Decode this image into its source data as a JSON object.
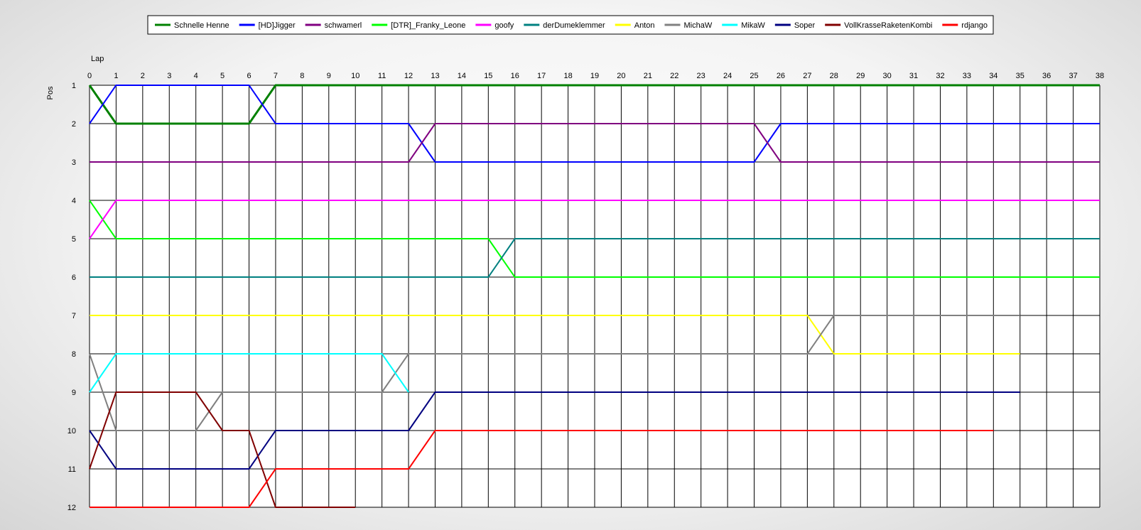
{
  "chart_data": {
    "type": "line",
    "xlabel": "Lap",
    "ylabel": "Pos",
    "xlim": [
      0,
      38
    ],
    "ylim": [
      1,
      12
    ],
    "y_inverted": true,
    "x_ticks": [
      0,
      1,
      2,
      3,
      4,
      5,
      6,
      7,
      8,
      9,
      10,
      11,
      12,
      13,
      14,
      15,
      16,
      17,
      18,
      19,
      20,
      21,
      22,
      23,
      24,
      25,
      26,
      27,
      28,
      29,
      30,
      31,
      32,
      33,
      34,
      35,
      36,
      37,
      38
    ],
    "y_ticks": [
      1,
      2,
      3,
      4,
      5,
      6,
      7,
      8,
      9,
      10,
      11,
      12
    ],
    "grid": true,
    "legend_position": "top-center",
    "series": [
      {
        "name": "Schnelle Henne",
        "color": "#008000",
        "width": 3,
        "points": [
          [
            0,
            1
          ],
          [
            1,
            2
          ],
          [
            6,
            2
          ],
          [
            7,
            1
          ],
          [
            38,
            1
          ]
        ]
      },
      {
        "name": "[HD]Jigger",
        "color": "#0000ff",
        "width": 2,
        "points": [
          [
            0,
            2
          ],
          [
            1,
            1
          ],
          [
            6,
            1
          ],
          [
            7,
            2
          ],
          [
            12,
            2
          ],
          [
            13,
            3
          ],
          [
            25,
            3
          ],
          [
            26,
            2
          ],
          [
            38,
            2
          ]
        ]
      },
      {
        "name": "schwamerl",
        "color": "#800080",
        "width": 2,
        "points": [
          [
            0,
            3
          ],
          [
            12,
            3
          ],
          [
            13,
            2
          ],
          [
            25,
            2
          ],
          [
            26,
            3
          ],
          [
            38,
            3
          ]
        ]
      },
      {
        "name": "[DTR]_Franky_Leone",
        "color": "#00ff00",
        "width": 2,
        "points": [
          [
            0,
            4
          ],
          [
            1,
            5
          ],
          [
            15,
            5
          ],
          [
            16,
            6
          ],
          [
            38,
            6
          ]
        ]
      },
      {
        "name": "goofy",
        "color": "#ff00ff",
        "width": 2,
        "points": [
          [
            0,
            5
          ],
          [
            1,
            4
          ],
          [
            38,
            4
          ]
        ]
      },
      {
        "name": "derDumeklemmer",
        "color": "#008080",
        "width": 2,
        "points": [
          [
            0,
            6
          ],
          [
            15,
            6
          ],
          [
            16,
            5
          ],
          [
            38,
            5
          ]
        ]
      },
      {
        "name": "Anton",
        "color": "#ffff00",
        "width": 2,
        "points": [
          [
            0,
            7
          ],
          [
            27,
            7
          ],
          [
            28,
            8
          ],
          [
            35,
            8
          ]
        ]
      },
      {
        "name": "MichaW",
        "color": "#808080",
        "width": 2,
        "points": [
          [
            0,
            8
          ],
          [
            1,
            10
          ],
          [
            4,
            10
          ],
          [
            5,
            9
          ],
          [
            11,
            9
          ],
          [
            12,
            8
          ],
          [
            27,
            8
          ],
          [
            28,
            7
          ],
          [
            35,
            7
          ]
        ]
      },
      {
        "name": "MikaW",
        "color": "#00ffff",
        "width": 2,
        "points": [
          [
            0,
            9
          ],
          [
            1,
            8
          ],
          [
            11,
            8
          ],
          [
            12,
            9
          ]
        ]
      },
      {
        "name": "Soper",
        "color": "#000080",
        "width": 2,
        "points": [
          [
            0,
            10
          ],
          [
            1,
            11
          ],
          [
            6,
            11
          ],
          [
            7,
            10
          ],
          [
            12,
            10
          ],
          [
            13,
            9
          ],
          [
            35,
            9
          ]
        ]
      },
      {
        "name": "VollKrasseRaketenKombi",
        "color": "#800000",
        "width": 2,
        "points": [
          [
            0,
            11
          ],
          [
            1,
            9
          ],
          [
            4,
            9
          ],
          [
            5,
            10
          ],
          [
            6,
            10
          ],
          [
            7,
            12
          ],
          [
            10,
            12
          ]
        ]
      },
      {
        "name": "rdjango",
        "color": "#ff0000",
        "width": 2,
        "points": [
          [
            0,
            12
          ],
          [
            6,
            12
          ],
          [
            7,
            11
          ],
          [
            12,
            11
          ],
          [
            13,
            10
          ],
          [
            34,
            10
          ]
        ]
      }
    ]
  }
}
